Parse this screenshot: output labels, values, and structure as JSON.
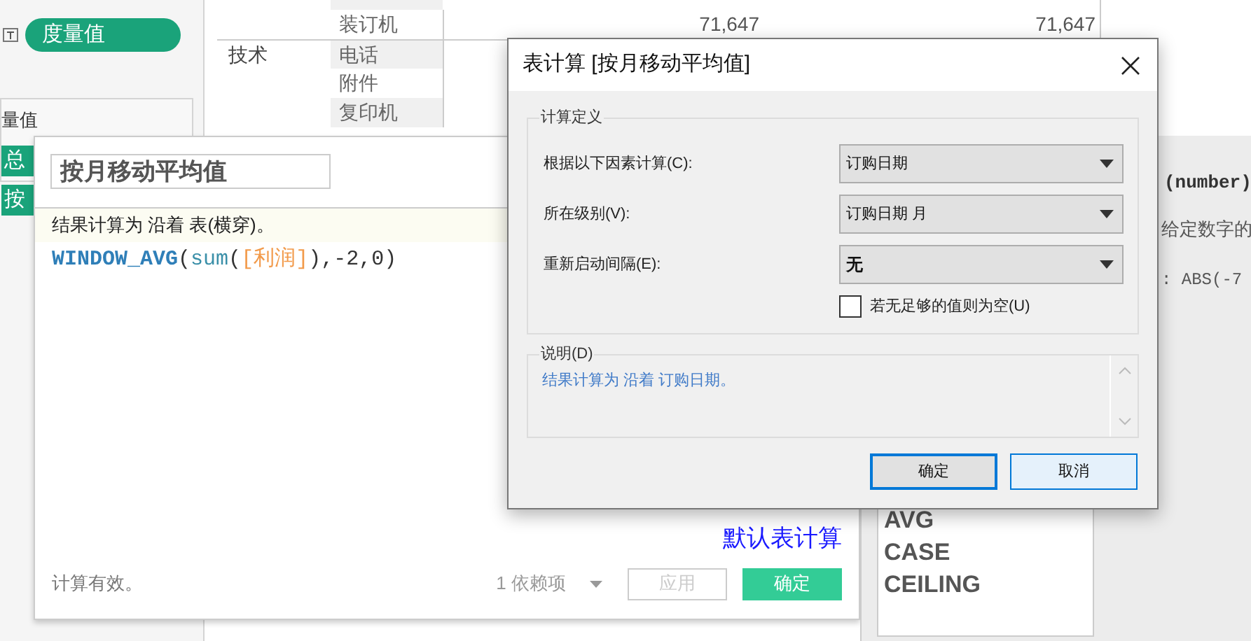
{
  "left_panel": {
    "pill": "度量值",
    "section_title": "量值",
    "pills": [
      "总",
      "按"
    ]
  },
  "table": {
    "rows": [
      {
        "category": "",
        "subcategory": "装订机",
        "column_3": "71,647",
        "column_4": "71,647",
        "shaded": false
      },
      {
        "category": "技术",
        "subcategory": "电话",
        "column_3": "",
        "column_4": "",
        "shaded": true
      },
      {
        "category": "",
        "subcategory": "附件",
        "column_3": "",
        "column_4": "",
        "shaded": false
      },
      {
        "category": "",
        "subcategory": "复印机",
        "column_3": "",
        "column_4": "",
        "shaded": true
      }
    ]
  },
  "editor": {
    "name": "按月移动平均值",
    "comment": "结果计算为  沿着 表(横穿)。",
    "formula": [
      {
        "kind": "function",
        "text": "WINDOW_AVG"
      },
      {
        "kind": "plain",
        "text": "("
      },
      {
        "kind": "aggregate",
        "text": "sum"
      },
      {
        "kind": "plain",
        "text": "("
      },
      {
        "kind": "field",
        "text": "[利润]"
      },
      {
        "kind": "plain",
        "text": "),-2,0)"
      }
    ],
    "default_link": "默认表计算",
    "status": "计算有效。",
    "dependencies": "1 依赖项",
    "buttons": [
      {
        "label": "应用",
        "disabled": true
      },
      {
        "label": "确定",
        "disabled": false
      }
    ]
  },
  "help_panel": {
    "signature": "(number)",
    "description": "给定数字的",
    "example": ": ABS(-7",
    "functions": [
      "AVG",
      "CASE",
      "CEILING"
    ]
  },
  "dialog": {
    "title": "表计算 [按月移动平均值]",
    "group_title": "计算定义",
    "fields": [
      {
        "label": "根据以下因素计算(C):",
        "value": "订购日期",
        "bold": false
      },
      {
        "label": "所在级别(V):",
        "value": "订购日期 月",
        "bold": false
      },
      {
        "label": "重新启动间隔(E):",
        "value": "无",
        "bold": true
      }
    ],
    "checkbox": {
      "label": "若无足够的值则为空(U)",
      "checked": false
    },
    "description_title": "说明(D)",
    "description": "结果计算为  沿着 订购日期。",
    "buttons": [
      {
        "label": "确定",
        "default": true
      },
      {
        "label": "取消",
        "default": false
      }
    ]
  }
}
